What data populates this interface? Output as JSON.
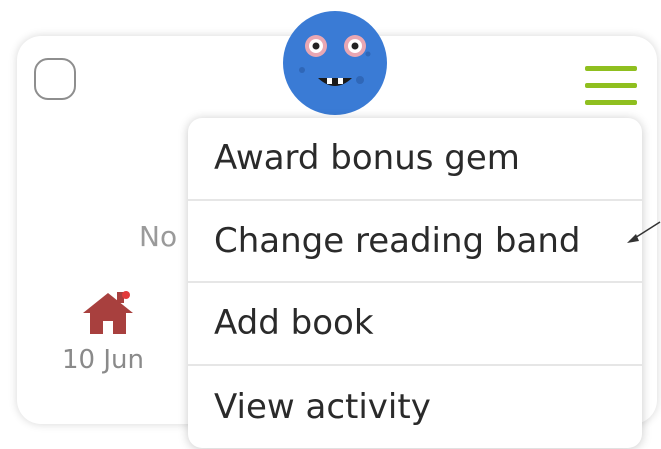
{
  "card": {
    "status_text": "No",
    "home_date": "10 Jun"
  },
  "menu": {
    "items": [
      {
        "label": "Award bonus gem"
      },
      {
        "label": "Change reading band"
      },
      {
        "label": "Add book"
      },
      {
        "label": "View activity"
      }
    ]
  },
  "icons": {
    "avatar": "blue-monster-avatar",
    "menu": "hamburger-menu-icon",
    "home": "home-icon",
    "arrow": "pointer-arrow-icon"
  },
  "colors": {
    "accent_green": "#8fbf1f",
    "avatar_blue": "#3a7bd5",
    "home_red": "#a8403e",
    "menu_text": "#2a2a2a",
    "muted_text": "#9a9a9a"
  }
}
